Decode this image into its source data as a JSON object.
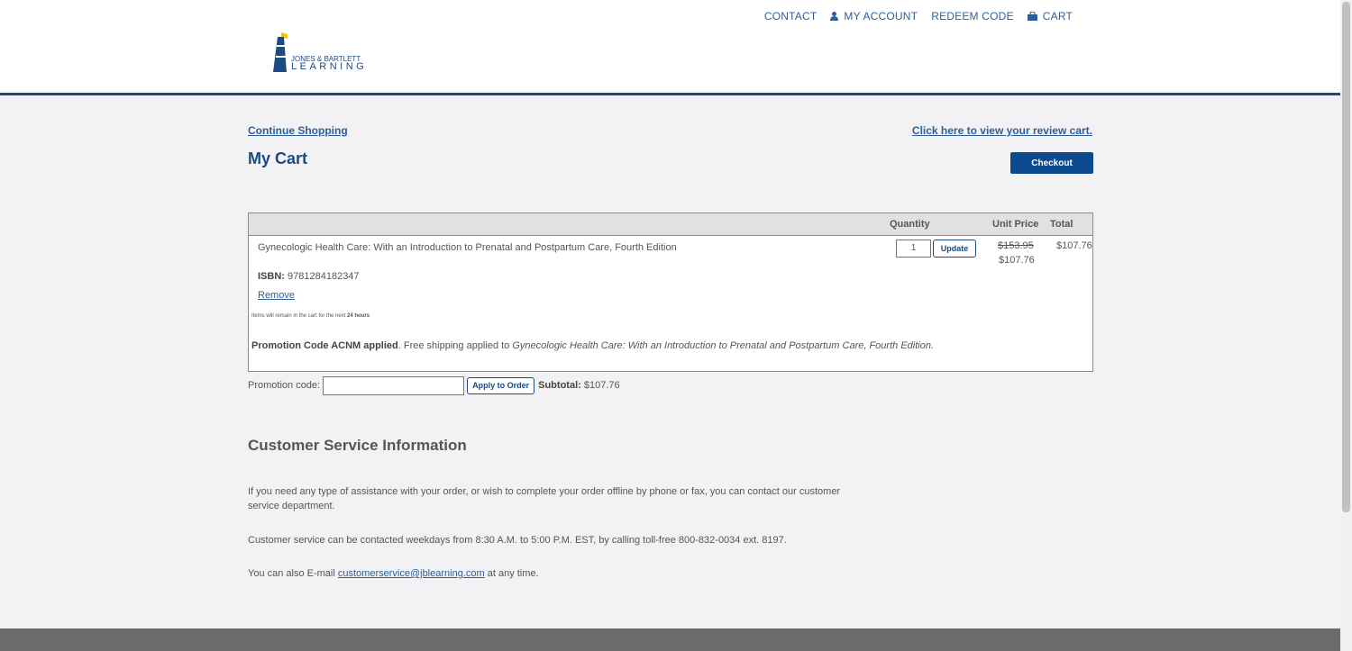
{
  "nav": {
    "contact": "CONTACT",
    "my_account": "MY ACCOUNT",
    "redeem_code": "REDEEM CODE",
    "cart": "CART"
  },
  "logo": {
    "line1": "JONES & BARTLETT",
    "line2": "LEARNING"
  },
  "colors": {
    "brand_blue": "#1d4a80",
    "link_blue": "#2f5f98",
    "checkout_blue": "#0c4a8e",
    "logo_yellow": "#f3c11b"
  },
  "cart": {
    "continue_shopping": "Continue Shopping",
    "review_link": "Click here to view your review cart.",
    "title": "My Cart",
    "checkout_label": "Checkout",
    "columns": {
      "quantity": "Quantity",
      "unit_price": "Unit Price",
      "total": "Total"
    },
    "item": {
      "title": "Gynecologic Health Care: With an Introduction to Prenatal and Postpartum Care, Fourth Edition",
      "isbn_label": "ISBN:",
      "isbn": "9781284182347",
      "remove_label": "Remove",
      "quantity": "1",
      "update_label": "Update",
      "original_price": "$153.95",
      "unit_price": "$107.76",
      "total": "$107.76"
    },
    "hold_notice_prefix": "Items will remain in the cart for the next ",
    "hold_notice_duration": "24 hours",
    "promo_applied_bold": "Promotion Code ACNM applied",
    "promo_applied_text": ". Free shipping applied to ",
    "promo_applied_item": "Gynecologic Health Care: With an Introduction to Prenatal and Postpartum Care, Fourth Edition."
  },
  "promo": {
    "label": "Promotion code:",
    "value": "",
    "apply_label": "Apply to Order",
    "subtotal_label": "Subtotal:",
    "subtotal_value": "$107.76"
  },
  "customer_service": {
    "title": "Customer Service Information",
    "p1": "If you need any type of assistance with your order, or wish to complete your order offline by phone or fax, you can contact our customer service department.",
    "p2": "Customer service can be contacted weekdays from 8:30 A.M. to 5:00 P.M. EST, by calling toll-free 800-832-0034 ext. 8197.",
    "p3_prefix": "You can also E-mail ",
    "email": "customerservice@jblearning.com",
    "p3_suffix": " at any time."
  }
}
